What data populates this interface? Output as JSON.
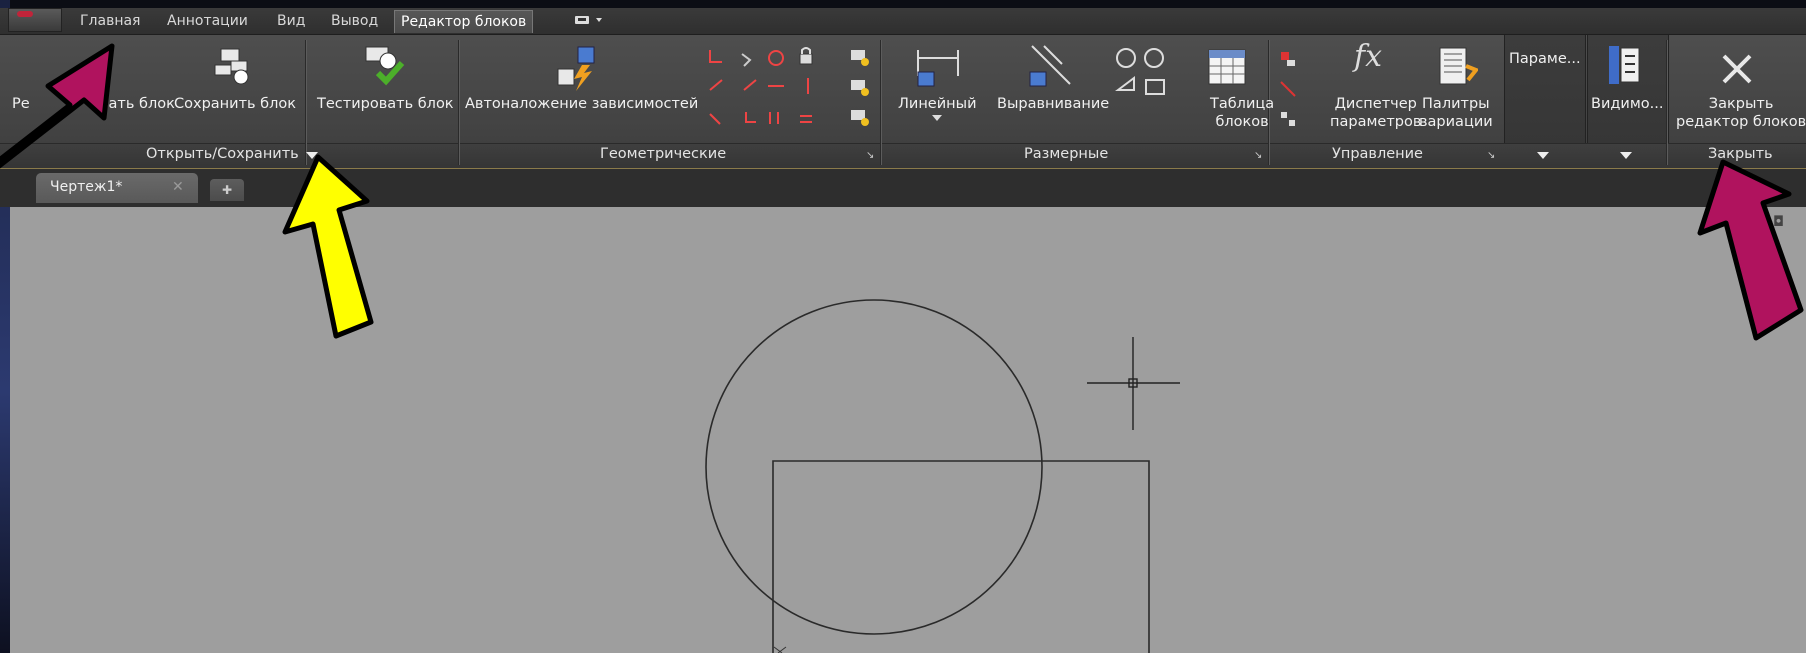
{
  "ribbon_tabs": [
    "Главная",
    "Аннотации",
    "Вид",
    "Вывод",
    "Редактор блоков"
  ],
  "active_tab": "Редактор блоков",
  "buttons": {
    "edit_block_partial": "Ре",
    "edit_block_partial2": "вать блок",
    "save_block": "Сохранить блок",
    "test_block": "Тестировать блок",
    "auto_constrain": "Автоналожение зависимостей",
    "linear": "Линейный",
    "aligned": "Выравнивание",
    "block_table_l1": "Таблица",
    "block_table_l2": "блоков",
    "param_manager_l1": "Диспетчер",
    "param_manager_l2": "параметров",
    "variation_palettes_l1": "Палитры",
    "variation_palettes_l2": "вариации",
    "params_short": "Параме...",
    "visibility_short": "Видимо...",
    "close_l1": "Закрыть",
    "close_l2": "редактор блоков"
  },
  "panels": {
    "open_save": "Открыть/Сохранить",
    "geometric": "Геометрические",
    "dimensional": "Размерные",
    "manage": "Управление",
    "close": "Закрыть"
  },
  "file_tab": {
    "name": "Чертеж1*"
  },
  "colors": {
    "ribbon_bg": "#4a4a4a",
    "canvas_bg": "#9e9e9e",
    "arrow_magenta": "#b0135e",
    "arrow_yellow": "#ffff00",
    "panel_accent": "#8a7a4a"
  },
  "icons": [
    "save-block-icon",
    "test-block-icon",
    "auto-constrain-icon",
    "linear-dim-icon",
    "aligned-dim-icon",
    "block-table-icon",
    "fx-icon",
    "variation-palette-icon",
    "visibility-icon",
    "close-x-icon"
  ]
}
